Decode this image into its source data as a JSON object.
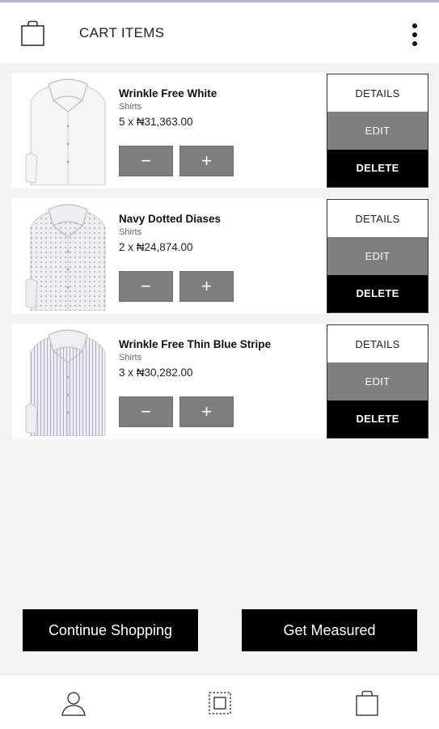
{
  "header": {
    "title": "CART ITEMS",
    "bag_icon": "shopping-bag-icon",
    "menu_icon": "more-vertical-icon"
  },
  "cart": {
    "items": [
      {
        "name": "Wrinkle Free White",
        "category": "Shirts",
        "price": "5 x ₦31,363.00",
        "shirt_color": "#f4f6f4",
        "pattern": "plain"
      },
      {
        "name": "Navy Dotted Diases",
        "category": "Shirts",
        "price": "2 x ₦24,874.00",
        "shirt_color": "#eceef2",
        "pattern": "dots"
      },
      {
        "name": "Wrinkle Free Thin Blue Stripe",
        "category": "Shirts",
        "price": "3 x ₦30,282.00",
        "shirt_color": "#eeeef4",
        "pattern": "stripes"
      }
    ],
    "minus_label": "−",
    "plus_label": "+",
    "details_label": "DETAILS",
    "edit_label": "EDIT",
    "delete_label": "DELETE"
  },
  "buttons": {
    "continue_shopping": "Continue Shopping",
    "get_measured": "Get Measured"
  },
  "navbar": {
    "items": [
      "profile-icon",
      "measure-frame-icon",
      "shopping-bag-icon"
    ]
  },
  "colors": {
    "edit_bg": "#7f7f7f",
    "delete_bg": "#000000",
    "quantity_button_bg": "#7e7e7e"
  }
}
